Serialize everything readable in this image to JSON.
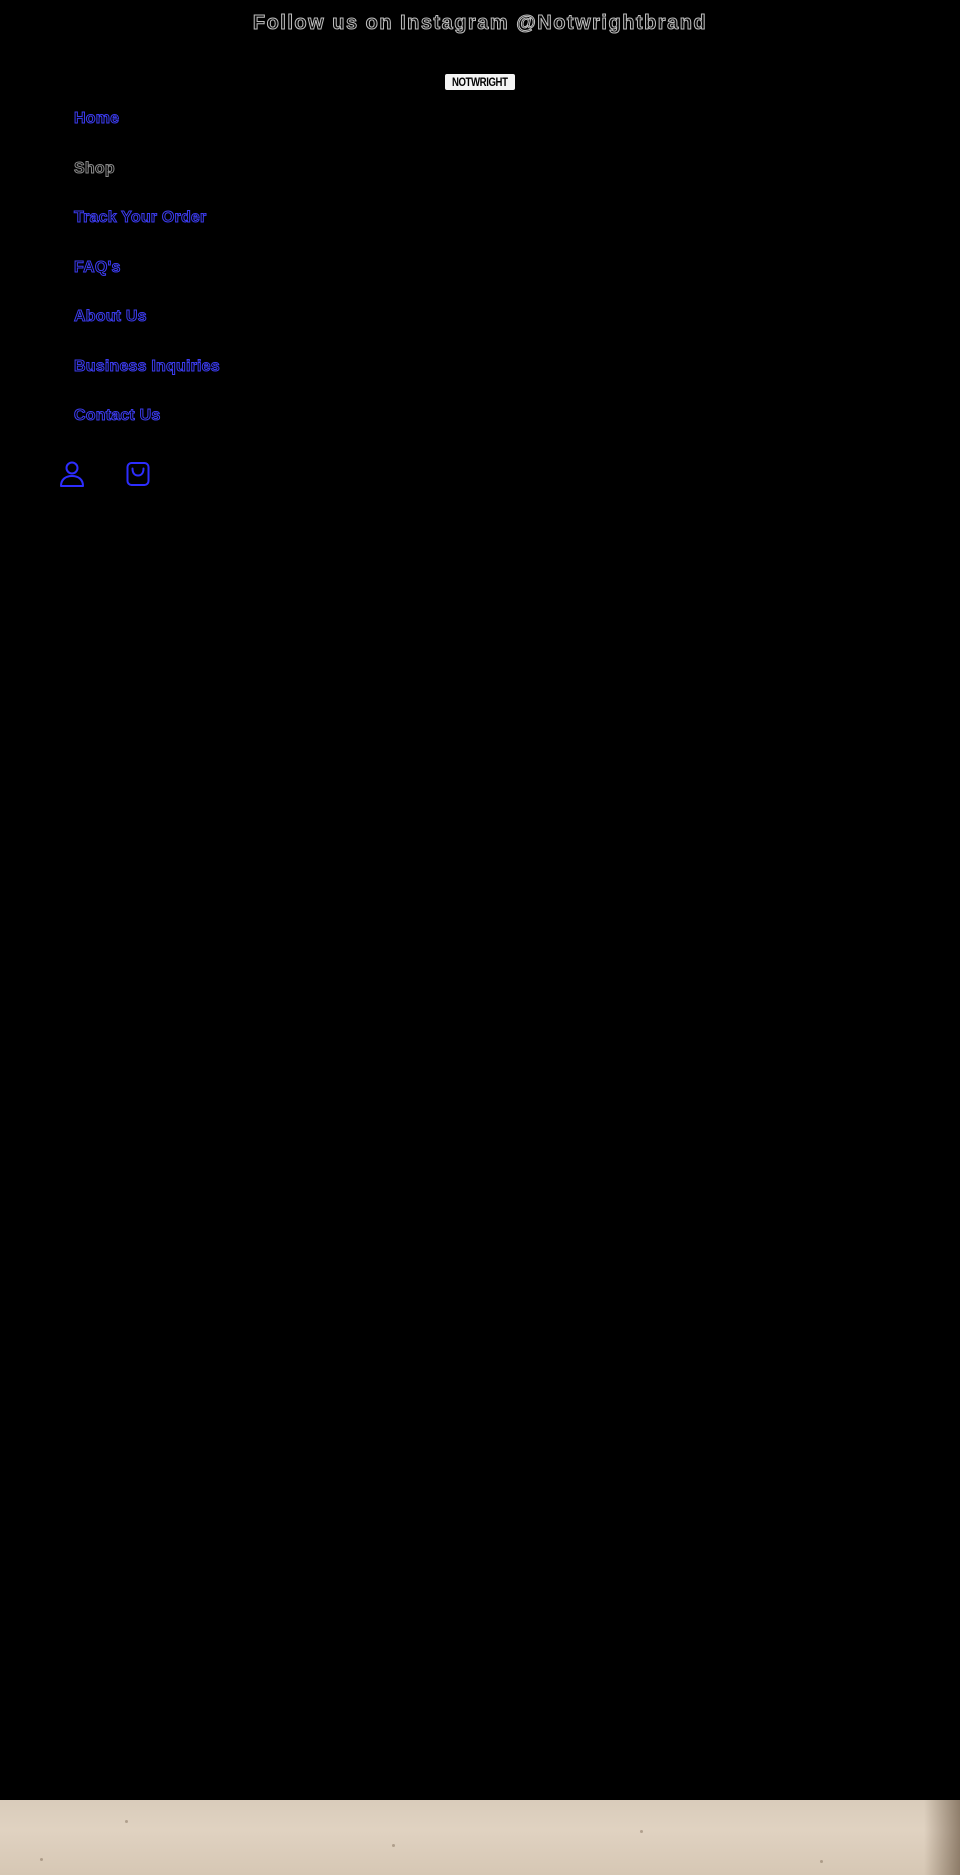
{
  "announcement": {
    "text": "Follow us on Instagram @Notwrightbrand"
  },
  "header": {
    "logo_text": "NOTWRIGHT",
    "nav": [
      {
        "label": "Home",
        "active": false
      },
      {
        "label": "Shop",
        "active": true
      },
      {
        "label": "Track Your Order",
        "active": false
      },
      {
        "label": "FAQ's",
        "active": false
      },
      {
        "label": "About Us",
        "active": false
      },
      {
        "label": "Business Inquiries",
        "active": false
      },
      {
        "label": "Contact Us",
        "active": false
      }
    ],
    "icons": {
      "account": "account-icon",
      "cart": "cart-icon"
    }
  },
  "colors": {
    "background": "#000000",
    "link": "#3c3cf0",
    "muted": "#8a8a8a",
    "wall": "#ddcfbe"
  }
}
